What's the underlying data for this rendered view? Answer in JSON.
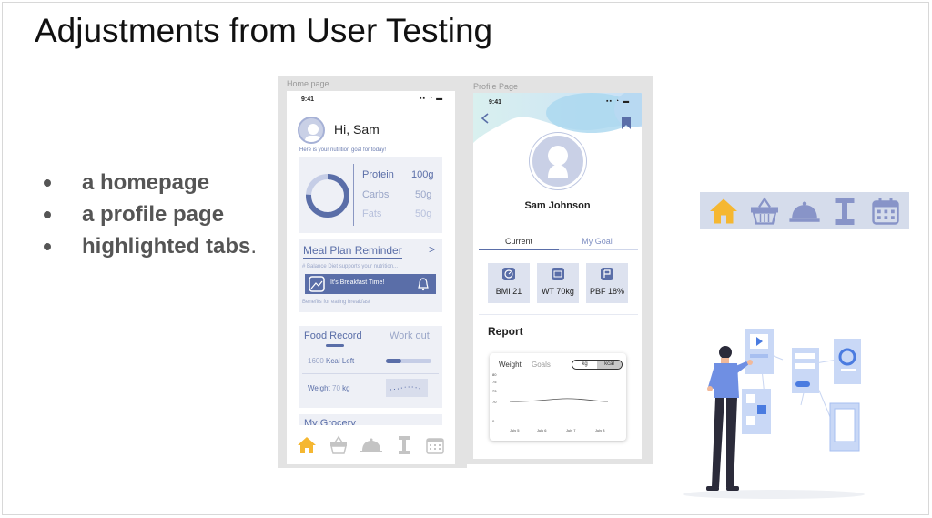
{
  "slide_title": "Adjustments from User Testing",
  "bullets": [
    {
      "text": "a homepage",
      "tail": ""
    },
    {
      "text": "a profile page",
      "tail": ""
    },
    {
      "text": "highlighted tabs",
      "tail": "."
    }
  ],
  "home": {
    "frame_label": "Home page",
    "time": "9:41",
    "greeting": "Hi, Sam",
    "goal_text": "Here is your nutrition goal for today!",
    "nutrients": [
      {
        "name": "Protein",
        "value": "100g"
      },
      {
        "name": "Carbs",
        "value": "50g"
      },
      {
        "name": "Fats",
        "value": "50g"
      }
    ],
    "meal_title": "Meal Plan Reminder",
    "meal_arrow": ">",
    "meal_sub": "# Balance Diet supports your nutrition...",
    "meal_banner": "It's Breakfast Time!",
    "meal_footer": "Benefits for eating breakfast",
    "tab_food": "Food Record",
    "tab_work": "Work out",
    "kcal_num": "1600",
    "kcal_label": "Kcal Left",
    "weight_label": "Weight",
    "weight_num": "70",
    "weight_unit": "kg",
    "grocery": "My Grocery"
  },
  "profile": {
    "frame_label": "Profile Page",
    "time": "9:41",
    "name": "Sam Johnson",
    "tab_current": "Current",
    "tab_goal": "My Goal",
    "stats": [
      "BMI 21",
      "WT 70kg",
      "PBF 18%"
    ],
    "report": "Report",
    "chart_weight": "Weight",
    "chart_goals": "Goals",
    "unit_kg": "kg",
    "unit_kcal": "kcal",
    "yticks": [
      "80",
      "75",
      "73",
      "70",
      "0"
    ],
    "xticks": [
      "July 5",
      "July 6",
      "July 7",
      "July 8"
    ]
  },
  "colors": {
    "accent": "#f5b731",
    "icon_blue": "#8894c8",
    "brand": "#5a6ea8"
  }
}
